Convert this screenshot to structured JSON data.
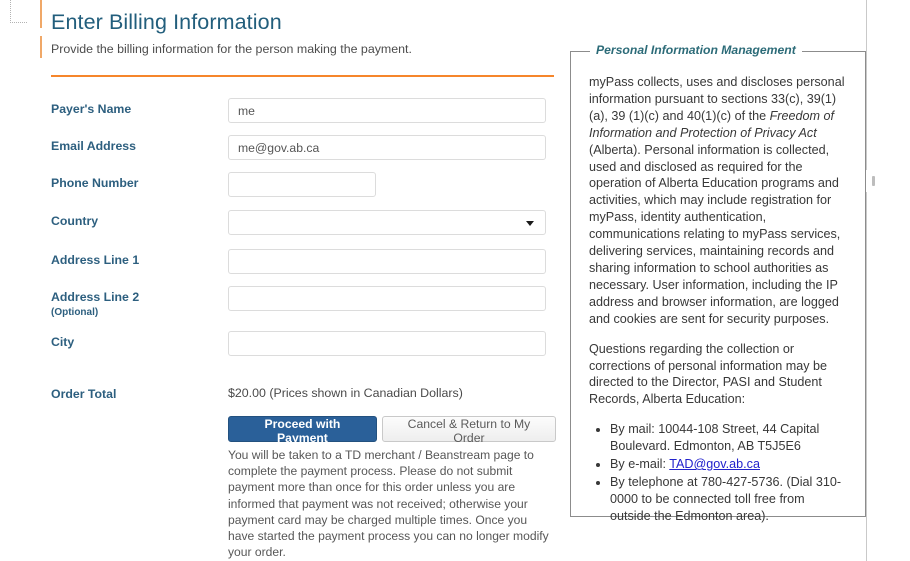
{
  "page": {
    "title": "Enter Billing Information",
    "subtitle": "Provide the billing information for the person making the payment."
  },
  "form": {
    "rows": [
      {
        "label": "Payer's Name",
        "sub": "",
        "value": "me",
        "control": "text",
        "width": "wide"
      },
      {
        "label": "Email Address",
        "sub": "",
        "value": "me@gov.ab.ca",
        "control": "text",
        "width": "wide"
      },
      {
        "label": "Phone Number",
        "sub": "",
        "value": "",
        "control": "text",
        "width": "narrow"
      },
      {
        "label": "Country",
        "sub": "",
        "value": "",
        "control": "select",
        "width": "wide"
      },
      {
        "label": "Address Line 1",
        "sub": "",
        "value": "",
        "control": "text",
        "width": "wide"
      },
      {
        "label": "Address Line 2",
        "sub": "(Optional)",
        "value": "",
        "control": "text",
        "width": "wide"
      },
      {
        "label": "City",
        "sub": "",
        "value": "",
        "control": "text",
        "width": "wide"
      }
    ],
    "order_total_label": "Order Total",
    "order_total_value": "$20.00 (Prices shown in Canadian Dollars)"
  },
  "buttons": {
    "proceed": "Proceed with Payment",
    "cancel": "Cancel & Return to My Order"
  },
  "payment_note": "You will be taken to a TD merchant / Beanstream page to complete the payment process. Please do not submit payment more than once for this order unless you are informed that payment was not received; otherwise your payment card may be charged multiple times. Once you have started the payment process you can no longer modify your order.",
  "pim": {
    "legend": "Personal Information Management",
    "para1_a": "myPass collects, uses and discloses personal information pursuant to sections 33(c), 39(1)(a), 39 (1)(c) and 40(1)(c) of the ",
    "para1_em": "Freedom of Information and Protection of Privacy Act",
    "para1_b": " (Alberta). Personal information is collected, used and disclosed as required for the operation of Alberta Education programs and activities, which may include registration for myPass, identity authentication, communications relating to myPass services, delivering services, maintaining records and sharing information to school authorities as necessary. User information, including the IP address and browser information, are logged and cookies are sent for security purposes.",
    "para2": "Questions regarding the collection or corrections of personal information may be directed to the Director, PASI and Student Records, Alberta Education:",
    "bullet_mail": "By mail: 10044-108 Street, 44 Capital Boulevard. Edmonton, AB T5J5E6",
    "bullet_email_prefix": "By e-mail: ",
    "bullet_email_link": "TAD@gov.ab.ca",
    "bullet_phone": "By telephone at 780-427-5736. (Dial 310-0000 to be connected toll free from outside the Edmonton area)."
  },
  "colors": {
    "heading": "#225e7c",
    "label": "#2d5f7f",
    "divider": "#f6862b",
    "primary_button": "#2a6099",
    "legend": "#2c6b78",
    "link": "#2222cc"
  }
}
